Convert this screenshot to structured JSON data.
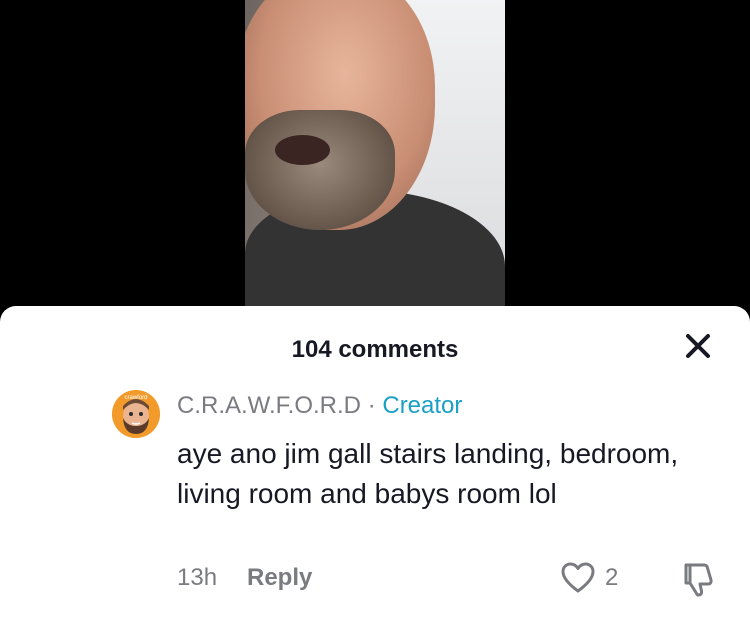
{
  "panel": {
    "title": "104 comments"
  },
  "comment": {
    "avatar_label": "crawford",
    "username": "C.R.A.W.F.O.R.D",
    "separator": "·",
    "badge": "Creator",
    "text": "aye ano jim gall stairs landing, bedroom, living room and babys room lol",
    "time": "13h",
    "reply_label": "Reply",
    "like_count": "2"
  },
  "icons": {
    "close": "close-icon",
    "like": "heart-icon",
    "dislike": "thumbs-down-icon"
  },
  "colors": {
    "creator_badge": "#1aa0c6",
    "muted_text": "#7a7b80",
    "primary_text": "#161823",
    "avatar_bg": "#f29b2b"
  }
}
